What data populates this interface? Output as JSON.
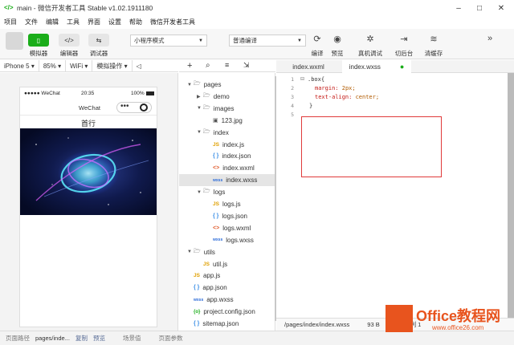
{
  "window": {
    "title": "main - 微信开发者工具 Stable v1.02.1911180",
    "app_icon": "code-icon",
    "minimize": "–",
    "maximize": "□",
    "close": "✕"
  },
  "menu": [
    "项目",
    "文件",
    "编辑",
    "工具",
    "界面",
    "设置",
    "帮助",
    "微信开发者工具"
  ],
  "toolbar": {
    "simulator_label": "模拟器",
    "editor_label": "编辑器",
    "debugger_label": "调试器",
    "mode_select": "小程序模式",
    "compile_select": "普通编译",
    "compile_label": "编译",
    "preview_label": "预览",
    "real_debug_label": "真机调试",
    "background_label": "切后台",
    "clear_cache_label": "清缓存",
    "more": "»"
  },
  "simbar": {
    "device": "iPhone 5",
    "zoom": "85%",
    "network": "WiFi",
    "sim_ops": "模拟操作"
  },
  "phone": {
    "carrier": "●●●●● WeChat",
    "time": "20:35",
    "battery": "100%",
    "nav_title": "WeChat",
    "capsule_dots": "•••",
    "heading": "首行"
  },
  "tree": {
    "items": [
      {
        "label": "pages",
        "type": "folder",
        "open": true,
        "depth": 0
      },
      {
        "label": "demo",
        "type": "folder",
        "open": false,
        "depth": 1
      },
      {
        "label": "images",
        "type": "folder",
        "open": true,
        "depth": 1
      },
      {
        "label": "123.jpg",
        "type": "img",
        "depth": 2
      },
      {
        "label": "index",
        "type": "folder",
        "open": true,
        "depth": 1
      },
      {
        "label": "index.js",
        "type": "js",
        "depth": 2
      },
      {
        "label": "index.json",
        "type": "json",
        "depth": 2
      },
      {
        "label": "index.wxml",
        "type": "wxml",
        "depth": 2
      },
      {
        "label": "index.wxss",
        "type": "wxss",
        "depth": 2,
        "selected": true
      },
      {
        "label": "logs",
        "type": "folder",
        "open": true,
        "depth": 1
      },
      {
        "label": "logs.js",
        "type": "js",
        "depth": 2
      },
      {
        "label": "logs.json",
        "type": "json",
        "depth": 2
      },
      {
        "label": "logs.wxml",
        "type": "wxml",
        "depth": 2
      },
      {
        "label": "logs.wxss",
        "type": "wxss",
        "depth": 2
      },
      {
        "label": "utils",
        "type": "folder",
        "open": true,
        "depth": 0
      },
      {
        "label": "util.js",
        "type": "js",
        "depth": 1
      },
      {
        "label": "app.js",
        "type": "js",
        "depth": 0
      },
      {
        "label": "app.json",
        "type": "json",
        "depth": 0
      },
      {
        "label": "app.wxss",
        "type": "wxss",
        "depth": 0
      },
      {
        "label": "project.config.json",
        "type": "cfg",
        "depth": 0
      },
      {
        "label": "sitemap.json",
        "type": "json",
        "depth": 0
      }
    ]
  },
  "editor": {
    "tabs": [
      {
        "label": "index.wxml"
      },
      {
        "label": "index.wxss",
        "active": true
      }
    ],
    "lines": [
      {
        "n": "1",
        "selector": ".box{"
      },
      {
        "n": "2",
        "prop": "margin:",
        "val": " 2px;"
      },
      {
        "n": "3",
        "prop": "text-align:",
        "val": " center;"
      },
      {
        "n": "4",
        "selector": "}"
      },
      {
        "n": "5",
        "selector": ""
      }
    ],
    "status_path": "/pages/index/index.wxss",
    "status_size": "93 B",
    "status_extra": "行 5,列 1"
  },
  "bottombar": {
    "page_path_label": "页面路径",
    "page_path": "pages/inde...",
    "copy": "复制",
    "preview": "预览",
    "scene": "场景值",
    "params": "页面参数"
  },
  "watermark": {
    "brand": "Office教程网",
    "url": "www.office26.com"
  },
  "colors": {
    "accent": "#1aad19",
    "highlight_box": "#e03a3a",
    "watermark": "#e8541e"
  }
}
